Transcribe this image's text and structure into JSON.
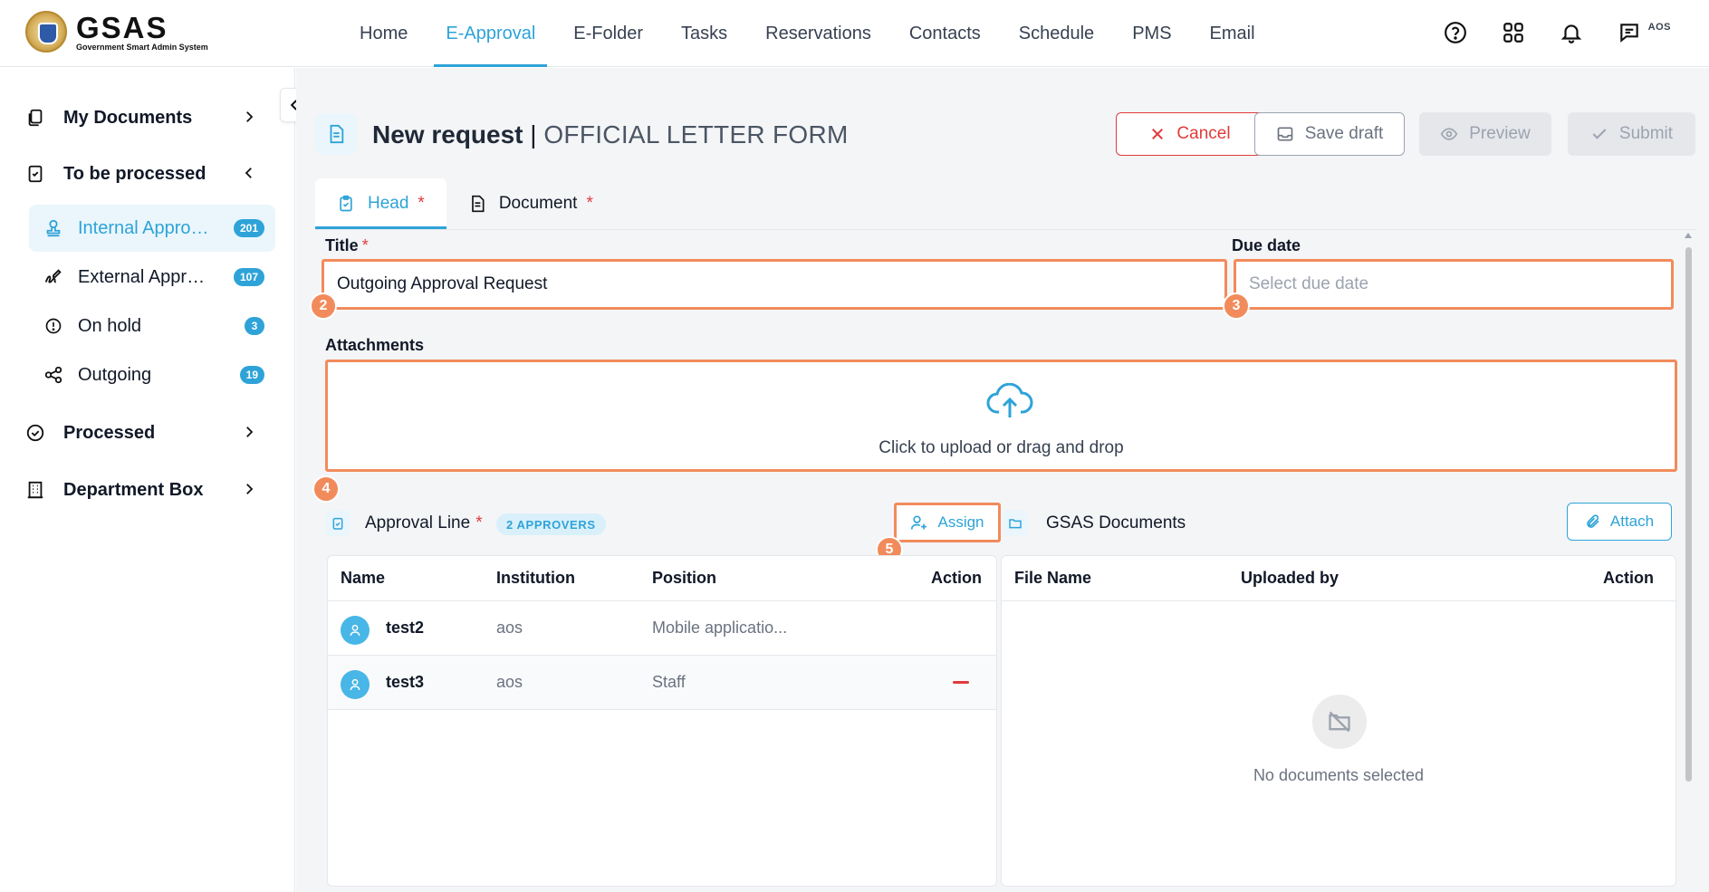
{
  "app": {
    "logo_name": "GSAS",
    "logo_subtitle": "Government Smart Admin System",
    "user_initials": "AOS"
  },
  "nav": {
    "items": [
      {
        "label": "Home"
      },
      {
        "label": "E-Approval",
        "active": true
      },
      {
        "label": "E-Folder"
      },
      {
        "label": "Tasks"
      },
      {
        "label": "Reservations"
      },
      {
        "label": "Contacts"
      },
      {
        "label": "Schedule"
      },
      {
        "label": "PMS"
      },
      {
        "label": "Email"
      }
    ],
    "icons": [
      "help-icon",
      "apps-grid-icon",
      "bell-icon",
      "chat-icon"
    ]
  },
  "sidebar": {
    "my_documents": "My Documents",
    "to_be_processed": "To be processed",
    "sub_items": [
      {
        "label": "Internal Approval",
        "badge": "201",
        "icon": "stamp-icon",
        "active": true
      },
      {
        "label": "External Approval",
        "badge": "107",
        "icon": "signature-icon"
      },
      {
        "label": "On hold",
        "badge": "3",
        "icon": "alert-circle-icon"
      },
      {
        "label": "Outgoing",
        "badge": "19",
        "icon": "share-icon"
      }
    ],
    "processed": "Processed",
    "department_box": "Department Box"
  },
  "page": {
    "title_prefix": "New request",
    "separator": " | ",
    "title_form": "OFFICIAL LETTER FORM"
  },
  "actions": {
    "cancel": "Cancel",
    "save_draft": "Save draft",
    "preview": "Preview",
    "submit": "Submit"
  },
  "tabs": [
    {
      "label": "Head",
      "required": "*",
      "active": true
    },
    {
      "label": "Document",
      "required": "*"
    }
  ],
  "form": {
    "title_label": "Title",
    "title_required": "*",
    "title_value": "Outgoing Approval Request",
    "due_date_label": "Due date",
    "due_date_placeholder": "Select due date",
    "attachments_label": "Attachments",
    "upload_text": "Click to upload or drag and drop"
  },
  "markers": [
    "2",
    "3",
    "4",
    "5"
  ],
  "approval": {
    "title": "Approval Line",
    "required": "*",
    "approvers_chip": "2 APPROVERS",
    "assign_label": "Assign",
    "columns": [
      "Name",
      "Institution",
      "Position",
      "Action"
    ],
    "rows": [
      {
        "name": "test2",
        "institution": "aos",
        "position": "Mobile applicatio..."
      },
      {
        "name": "test3",
        "institution": "aos",
        "position": "Staff"
      }
    ]
  },
  "gsas_documents": {
    "title": "GSAS Documents",
    "attach_label": "Attach",
    "columns": [
      "File Name",
      "Uploaded by",
      "Action"
    ],
    "empty_text": "No documents selected"
  },
  "colors": {
    "accent": "#2ea3d8",
    "danger": "#e03b3b",
    "highlight": "#f28b5b"
  }
}
